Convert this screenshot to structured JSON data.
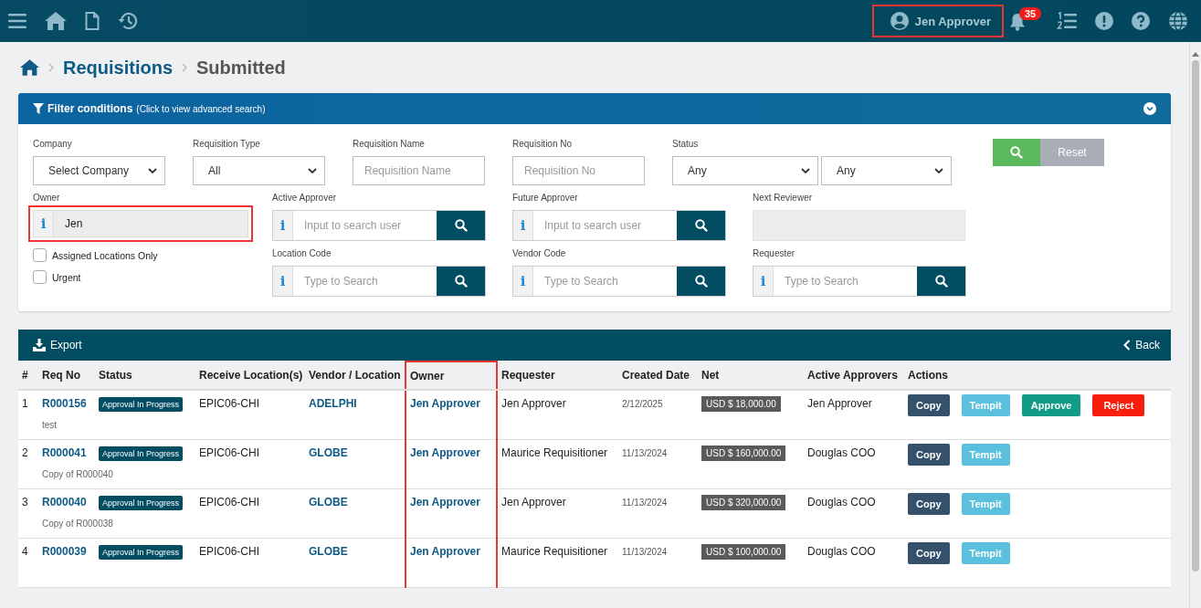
{
  "topbar": {
    "user": {
      "name": "Jen Approver",
      "highlighted": true
    },
    "notifications": {
      "count": "35"
    }
  },
  "breadcrumb": [
    {
      "label": "Requisitions",
      "current": false
    },
    {
      "label": "Submitted",
      "current": true
    }
  ],
  "filter": {
    "title": "Filter conditions",
    "hint": "(Click to view advanced search)",
    "expanded": false,
    "top_row": [
      {
        "kind": "select",
        "label": "Company",
        "value": "Select Company"
      },
      {
        "kind": "select",
        "label": "Requisition Type",
        "value": "All"
      },
      {
        "kind": "text",
        "label": "Requisition Name",
        "placeholder": "Requisition Name"
      },
      {
        "kind": "text",
        "label": "Requisition No",
        "placeholder": "Requisition No"
      },
      {
        "kind": "status",
        "label": "Status",
        "values": [
          "Any",
          "Any"
        ]
      }
    ],
    "rows": [
      [
        {
          "kind": "info",
          "label": "Owner",
          "info": "i",
          "value": "Jen",
          "highlighted": true
        },
        {
          "kind": "lookup",
          "label": "Active Approver",
          "info": "i",
          "placeholder": "Input to search user"
        },
        {
          "kind": "lookup",
          "label": "Future Approver",
          "info": "i",
          "placeholder": "Input to search user"
        },
        {
          "kind": "readonly",
          "label": "Next Reviewer"
        }
      ],
      [
        {
          "kind": "checks",
          "items": [
            {
              "label": "Assigned Locations Only",
              "checked": false
            },
            {
              "label": "Urgent",
              "checked": false
            }
          ]
        },
        {
          "kind": "lookup",
          "label": "Location Code",
          "info": "i",
          "placeholder": "Type to Search"
        },
        {
          "kind": "lookup",
          "label": "Vendor Code",
          "info": "i",
          "placeholder": "Type to Search"
        },
        {
          "kind": "lookup",
          "label": "Requester",
          "info": "i",
          "placeholder": "Type to Search"
        }
      ]
    ],
    "reset": "Reset"
  },
  "table": {
    "export": "Export",
    "back": "Back",
    "columns": [
      {
        "label": "#",
        "highlighted": false
      },
      {
        "label": "Req No",
        "highlighted": false
      },
      {
        "label": "Status",
        "highlighted": false
      },
      {
        "label": "Receive Location(s)",
        "highlighted": false
      },
      {
        "label": "Vendor / Location",
        "highlighted": false
      },
      {
        "label": "Owner",
        "highlighted": true
      },
      {
        "label": "Requester",
        "highlighted": false
      },
      {
        "label": "Created Date",
        "highlighted": false
      },
      {
        "label": "Net",
        "highlighted": false
      },
      {
        "label": "Active Approvers",
        "highlighted": false
      },
      {
        "label": "Actions",
        "highlighted": false
      }
    ],
    "rows": [
      {
        "num": "1",
        "req_no": "R000156",
        "description": "test",
        "status": "Approval In Progress",
        "location": "EPIC06-CHI",
        "vendor": "ADELPHI",
        "owner": "Jen Approver",
        "requester": "Jen Approver",
        "date": "2/12/2025",
        "net": "USD $ 18,000.00",
        "approver": "Jen Approver",
        "actions": [
          {
            "kind": "copy",
            "label": "Copy"
          },
          {
            "kind": "tempit",
            "label": "Tempit"
          },
          {
            "kind": "approve",
            "label": "Approve"
          },
          {
            "kind": "reject",
            "label": "Reject"
          }
        ]
      },
      {
        "num": "2",
        "req_no": "R000041",
        "description": "Copy of R000040",
        "status": "Approval In Progress",
        "location": "EPIC06-CHI",
        "vendor": "GLOBE",
        "owner": "Jen Approver",
        "requester": "Maurice Requisitioner",
        "date": "11/13/2024",
        "net": "USD $ 160,000.00",
        "approver": "Douglas COO",
        "actions": [
          {
            "kind": "copy",
            "label": "Copy"
          },
          {
            "kind": "tempit",
            "label": "Tempit"
          }
        ]
      },
      {
        "num": "3",
        "req_no": "R000040",
        "description": "Copy of R000038",
        "status": "Approval In Progress",
        "location": "EPIC06-CHI",
        "vendor": "GLOBE",
        "owner": "Jen Approver",
        "requester": "Jen Approver",
        "date": "11/13/2024",
        "net": "USD $ 320,000.00",
        "approver": "Douglas COO",
        "actions": [
          {
            "kind": "copy",
            "label": "Copy"
          },
          {
            "kind": "tempit",
            "label": "Tempit"
          }
        ]
      },
      {
        "num": "4",
        "req_no": "R000039",
        "status": "Approval In Progress",
        "location": "EPIC06-CHI",
        "vendor": "GLOBE",
        "owner": "Jen Approver",
        "requester": "Maurice Requisitioner",
        "date": "11/13/2024",
        "net": "USD $ 100,000.00",
        "approver": "Douglas COO",
        "actions": [
          {
            "kind": "copy",
            "label": "Copy"
          },
          {
            "kind": "tempit",
            "label": "Tempit"
          }
        ]
      }
    ]
  }
}
